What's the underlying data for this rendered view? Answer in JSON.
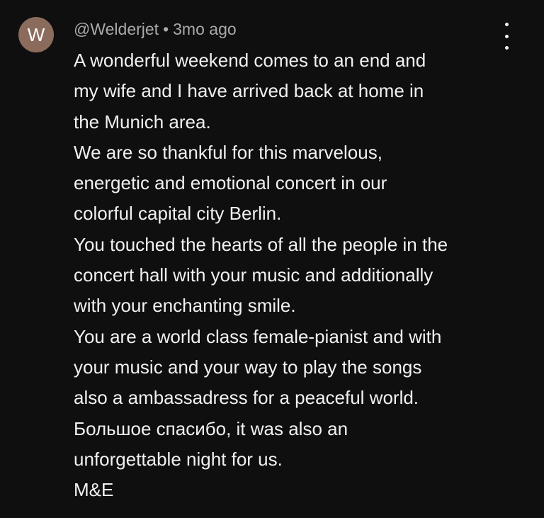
{
  "comment": {
    "avatar_letter": "W",
    "avatar_color": "#8a6b5c",
    "author": "@Welderjet",
    "separator": "•",
    "time": "3mo ago",
    "menu_icon": "more-vertical-icon",
    "lines": [
      "A wonderful weekend comes to an end and",
      "my wife and I have arrived back at home in",
      "the Munich area.",
      "We are so thankful for this marvelous,",
      "energetic and emotional concert in our",
      "colorful capital city Berlin.",
      "You touched the hearts of all the people in the",
      "concert hall with your music and additionally",
      "with your enchanting smile.",
      "You are a world class female-pianist and with",
      "your music and your way to play the songs",
      "also a ambassadress for a peaceful world.",
      "Большое спасибо, it was also an",
      "unforgettable night for us.",
      "M&E"
    ]
  }
}
